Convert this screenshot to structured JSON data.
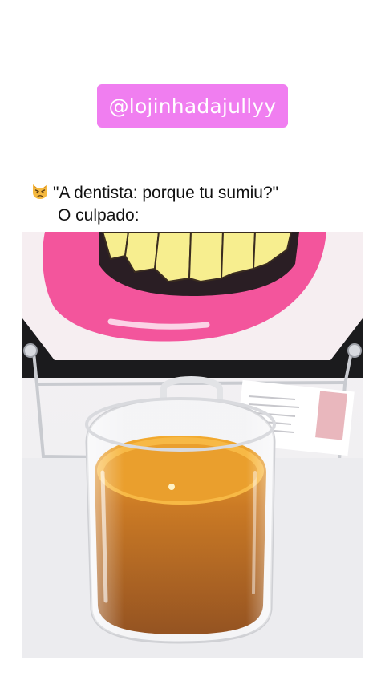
{
  "watermark": {
    "handle": "@lojinhadajullyy",
    "background_color": "#f07ef0"
  },
  "caption": {
    "emoji": "angry-cat-emoji",
    "line1": "\"A dentista: porque tu sumiu?\"",
    "line2": "O culpado:"
  },
  "photo": {
    "icon": "photo-of-pink-mouth-poster-and-glass-of-tea"
  }
}
